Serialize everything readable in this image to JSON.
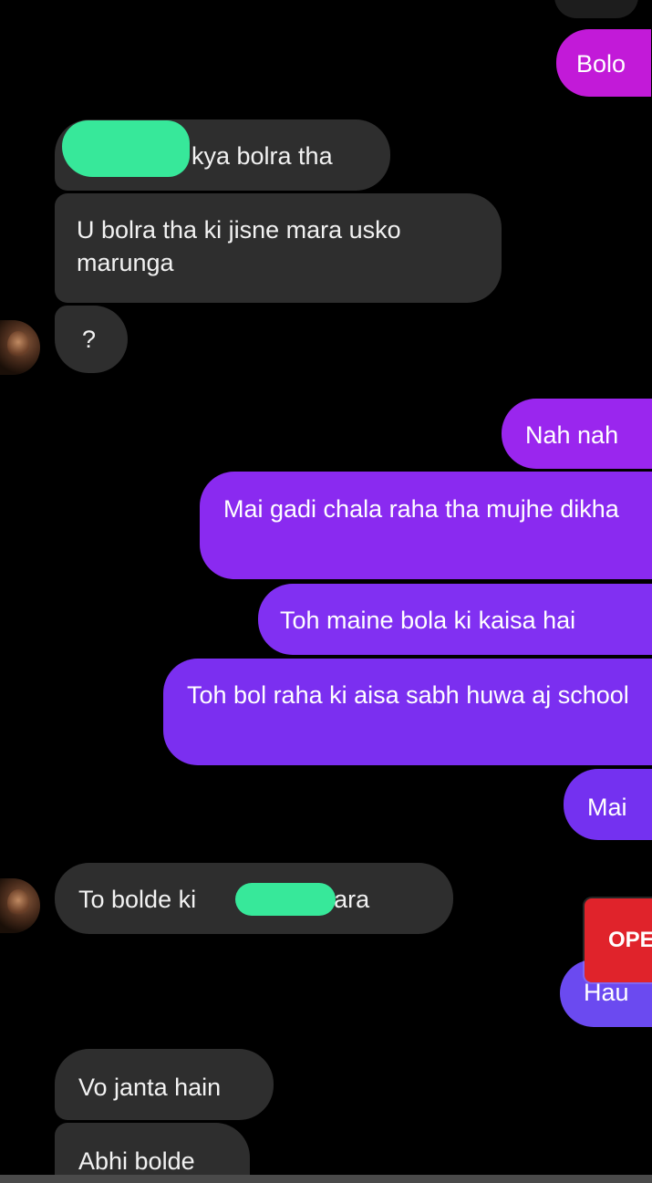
{
  "messages": [
    {
      "id": "m1",
      "side": "out",
      "text": "Bolo"
    },
    {
      "id": "m2",
      "side": "in",
      "text": "kya bolra tha"
    },
    {
      "id": "m3",
      "side": "in",
      "text": "U bolra tha ki jisne mara usko marunga"
    },
    {
      "id": "m4",
      "side": "in",
      "text": "?"
    },
    {
      "id": "m5",
      "side": "out",
      "text": "Nah nah"
    },
    {
      "id": "m6",
      "side": "out",
      "text": "Mai gadi chala raha tha mujhe dikha"
    },
    {
      "id": "m7",
      "side": "out",
      "text": "Toh maine bola ki kaisa hai"
    },
    {
      "id": "m8",
      "side": "out",
      "text": "Toh bol raha ki aisa sabh huwa aj school"
    },
    {
      "id": "m9",
      "side": "out",
      "text": "Mai"
    },
    {
      "id": "m10",
      "side": "in",
      "text_start": "To bolde ki",
      "text_end": "e mara"
    },
    {
      "id": "m11",
      "side": "out",
      "text": "Hau"
    },
    {
      "id": "m12",
      "side": "in",
      "text": "Vo janta hain"
    },
    {
      "id": "m13",
      "side": "in",
      "text": "Abhi bolde"
    }
  ],
  "overlay": {
    "open_button_label": "OPEN"
  },
  "colors": {
    "incoming_bubble": "#2e2e2e",
    "outgoing_magenta": "#c21ad8",
    "outgoing_violet": "#7b2ff0",
    "redaction": "#37e89a",
    "open_button": "#e0232b"
  }
}
